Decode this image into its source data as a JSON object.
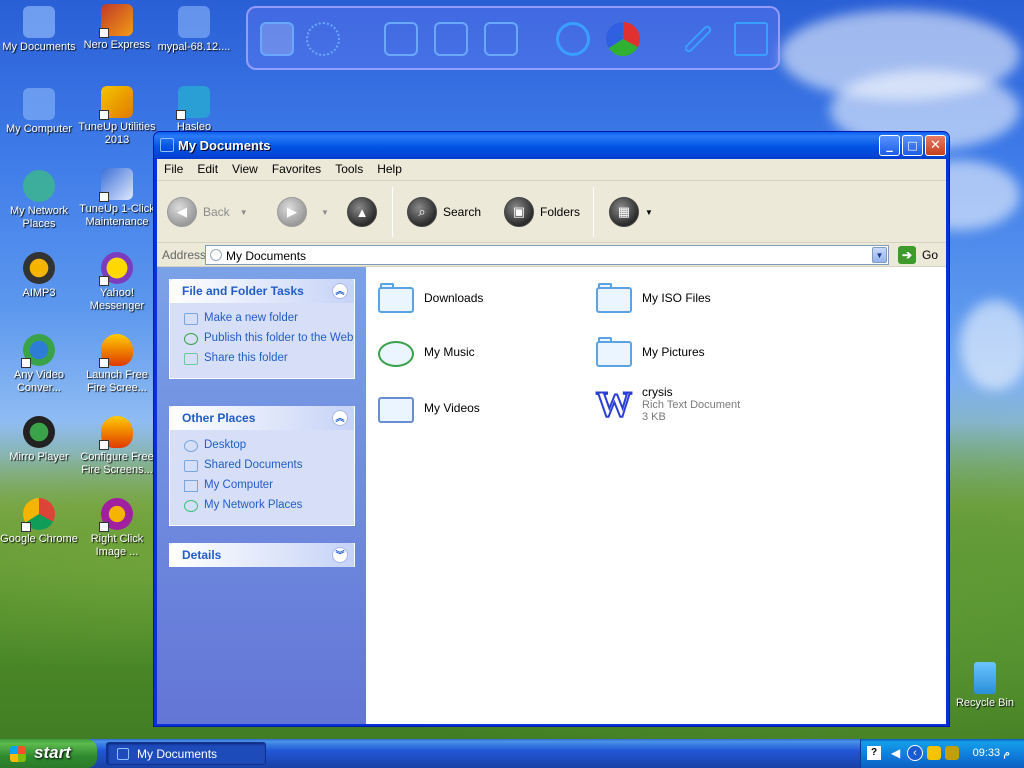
{
  "desktop": {
    "icons": [
      {
        "label": "My Documents"
      },
      {
        "label": "Nero Express"
      },
      {
        "label": "mypal-68.12...."
      },
      {
        "label": "My Computer"
      },
      {
        "label": "TuneUp Utilities 2013"
      },
      {
        "label": "Hasleo"
      },
      {
        "label": "My Network Places"
      },
      {
        "label": "TuneUp 1-Click Maintenance"
      },
      {
        "label": "AIMP3"
      },
      {
        "label": "Yahoo! Messenger"
      },
      {
        "label": "Any Video Conver..."
      },
      {
        "label": "Launch Free Fire Scree..."
      },
      {
        "label": "Mirro Player"
      },
      {
        "label": "Configure Free Fire Screens..."
      },
      {
        "label": "Google Chrome"
      },
      {
        "label": "Right Click Image ..."
      },
      {
        "label": "Recycle Bin"
      }
    ]
  },
  "window": {
    "title": "My Documents",
    "controls": {
      "minimize": "_",
      "maximize": "□",
      "close": "✕"
    },
    "menu": [
      "File",
      "Edit",
      "View",
      "Favorites",
      "Tools",
      "Help"
    ],
    "toolbar": {
      "back": "Back",
      "search": "Search",
      "folders": "Folders"
    },
    "address": {
      "label": "Address",
      "value": "My Documents",
      "go": "Go"
    },
    "tasks": {
      "title": "File and Folder Tasks",
      "links": [
        "Make a new folder",
        "Publish this folder to the Web",
        "Share this folder"
      ]
    },
    "places": {
      "title": "Other Places",
      "links": [
        "Desktop",
        "Shared Documents",
        "My Computer",
        "My Network Places"
      ]
    },
    "details": {
      "title": "Details"
    },
    "items": [
      {
        "name": "Downloads"
      },
      {
        "name": "My ISO Files"
      },
      {
        "name": "My Music"
      },
      {
        "name": "My Pictures"
      },
      {
        "name": "My Videos"
      },
      {
        "name": "crysis",
        "type": "Rich Text Document",
        "size": "3 KB"
      }
    ]
  },
  "taskbar": {
    "start": "start",
    "task": "My Documents",
    "clock": "09:33 م"
  },
  "colors": {
    "titlebar": "#0054e3",
    "link": "#215dc6",
    "start": "#3c9a3c"
  }
}
